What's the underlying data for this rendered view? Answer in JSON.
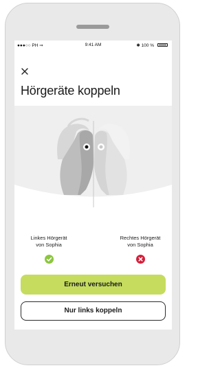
{
  "status_bar": {
    "carrier": "●●●○○ PH ⇒",
    "time": "9:41 AM",
    "battery": "✱ 100 %"
  },
  "screen": {
    "title": "Hörgeräte koppeln",
    "close_icon": "close-icon"
  },
  "devices": [
    {
      "label_line1": "Linkes Hörgerät",
      "label_line2": "von Sophia",
      "status": "paired",
      "status_icon": "check-icon",
      "color": "#8cc63f"
    },
    {
      "label_line1": "Rechtes Hörgerät",
      "label_line2": "von Sophia",
      "status": "failed",
      "status_icon": "x-icon",
      "color": "#d51f3a"
    }
  ],
  "buttons": {
    "retry": "Erneut versuchen",
    "left_only": "Nur links koppeln"
  },
  "colors": {
    "accent": "#c5dc5f",
    "success": "#8cc63f",
    "error": "#d51f3a"
  }
}
